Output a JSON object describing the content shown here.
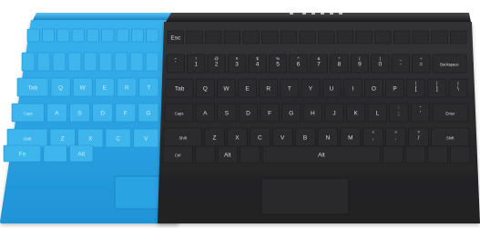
{
  "blue_cover": {
    "color": "#2ea8e6",
    "edge_color": "#1d8fd0",
    "key_color": "#3fb5ee",
    "label_color": "#cdeeff",
    "function_row": [
      "",
      "",
      "",
      "",
      "",
      "",
      "",
      "",
      ""
    ],
    "number_row": [
      "",
      "",
      "",
      "",
      "",
      "",
      "",
      "",
      ""
    ],
    "qwerty_row": [
      "Tab",
      "Q",
      "W",
      "E",
      "R",
      "T"
    ],
    "home_row": [
      "Caps",
      "A",
      "S",
      "D",
      "F",
      "G"
    ],
    "shift_row": [
      "Shift",
      "Z",
      "X",
      "C",
      "V"
    ],
    "bottom_row": [
      "Fn",
      "",
      "Alt"
    ]
  },
  "black_cover": {
    "color": "#2b2b2d",
    "edge_color": "#19191a",
    "key_color": "#2b2b2d",
    "label_color": "#d8d8d8",
    "function_row": [
      "Esc",
      "",
      "",
      "",
      "",
      "",
      "",
      "",
      "",
      "",
      "",
      "",
      "",
      "",
      "",
      ""
    ],
    "number_row": [
      "`",
      "1",
      "2",
      "3",
      "4",
      "5",
      "6",
      "7",
      "8",
      "9",
      "0",
      "-",
      "=",
      "Backspace"
    ],
    "number_shift": [
      "~",
      "!",
      "@",
      "#",
      "$",
      "%",
      "^",
      "&",
      "*",
      "(",
      ")",
      "_",
      "+",
      ""
    ],
    "qwerty_row": [
      "Tab",
      "Q",
      "W",
      "E",
      "R",
      "T",
      "Y",
      "U",
      "I",
      "O",
      "P",
      "[",
      "]",
      "\\"
    ],
    "qwerty_shift": [
      "",
      "",
      "",
      "",
      "",
      "",
      "",
      "",
      "",
      "",
      "",
      "{",
      "}",
      "|"
    ],
    "home_row": [
      "Caps",
      "A",
      "S",
      "D",
      "F",
      "G",
      "H",
      "J",
      "K",
      "L",
      ";",
      "'",
      "Enter"
    ],
    "home_shift": [
      "",
      "",
      "",
      "",
      "",
      "",
      "",
      "",
      "",
      "",
      ":",
      "\"",
      ""
    ],
    "shift_row": [
      "Shift",
      "Z",
      "X",
      "C",
      "V",
      "B",
      "N",
      "M",
      ",",
      ".",
      "/",
      "Shift"
    ],
    "shift_shift": [
      "",
      "",
      "",
      "",
      "",
      "",
      "",
      "",
      "<",
      ">",
      "?",
      ""
    ],
    "bottom_row": [
      "Ctrl",
      "",
      "Alt",
      "",
      "Alt",
      "",
      "",
      "",
      ""
    ]
  }
}
